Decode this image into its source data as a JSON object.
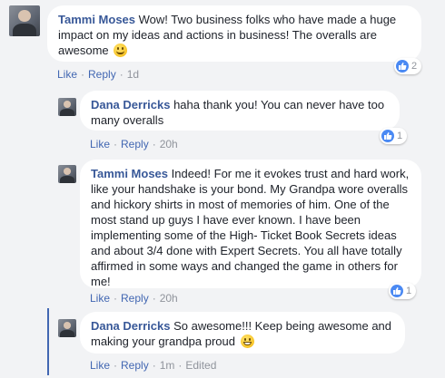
{
  "comments": [
    {
      "author": "Tammi Moses",
      "text_lines": [
        "Wow! Two business folks who have made a huge",
        "impact on my ideas and actions in business! The overalls are",
        "awesome"
      ],
      "emoji": "slightly-smiling-face-icon",
      "actions": {
        "like": "Like",
        "reply": "Reply",
        "time": "1d"
      },
      "reaction_count": "2"
    },
    {
      "author": "Dana Derricks",
      "text_lines": [
        "haha thank you! You can never have too",
        "many overalls"
      ],
      "actions": {
        "like": "Like",
        "reply": "Reply",
        "time": "20h"
      },
      "reaction_count": "1"
    },
    {
      "author": "Tammi Moses",
      "text_lines": [
        "Indeed! For me it evokes trust and hard work,",
        "like your handshake is your bond. My Grandpa wore overalls",
        "and hickory shirts in most of memories of him. One of the",
        "most stand up guys I have ever known. I have been",
        "implementing some of the High- Ticket Book Secrets ideas",
        "and about 3/4 done with Expert Secrets. You all have totally",
        "affirmed in some ways and changed the game in others for",
        "me!"
      ],
      "actions": {
        "like": "Like",
        "reply": "Reply",
        "time": "20h"
      },
      "reaction_count": "1"
    },
    {
      "author": "Dana Derricks",
      "text_lines": [
        "So awesome!!! Keep being awesome and",
        "making your grandpa proud"
      ],
      "emoji": "grinning-face-icon",
      "actions": {
        "like": "Like",
        "reply": "Reply",
        "time": "1m",
        "edited": "Edited"
      }
    }
  ],
  "colors": {
    "author": "#385898",
    "link": "#4267b2",
    "background": "#f2f3f5",
    "like_blue": "#4a89f3"
  }
}
